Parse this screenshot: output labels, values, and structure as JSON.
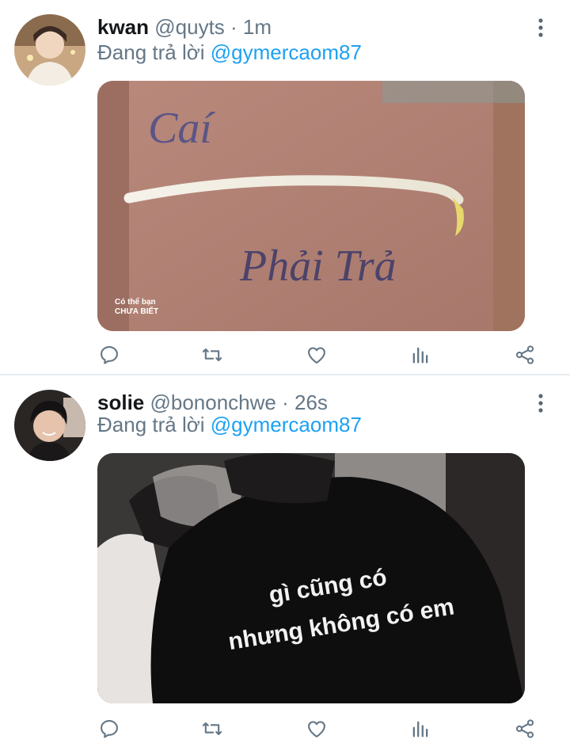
{
  "colors": {
    "name": "#14171a",
    "meta": "#657786",
    "link": "#1da1f2",
    "divider": "#e6ecf0"
  },
  "tweets": [
    {
      "name": "kwan",
      "handle": "@quyts",
      "time": "· 1m",
      "reply_prefix": "Đang trả lời ",
      "reply_user": "@gymercaom87",
      "media": {
        "overlay_1": "Caí",
        "overlay_2": "Phải Trả",
        "watermark_1": "Có thể bạn",
        "watermark_2": "CHƯA BIẾT"
      },
      "actions": [
        "reply-icon",
        "retweet-icon",
        "like-icon",
        "analytics-icon",
        "share-icon"
      ]
    },
    {
      "name": "solie",
      "handle": "@bononchwe",
      "time": "· 26s",
      "reply_prefix": "Đang trả lời ",
      "reply_user": "@gymercaom87",
      "media": {
        "overlay_1": "gì cũng có",
        "overlay_2": "nhưng không có em"
      },
      "actions": [
        "reply-icon",
        "retweet-icon",
        "like-icon",
        "analytics-icon",
        "share-icon"
      ]
    }
  ]
}
